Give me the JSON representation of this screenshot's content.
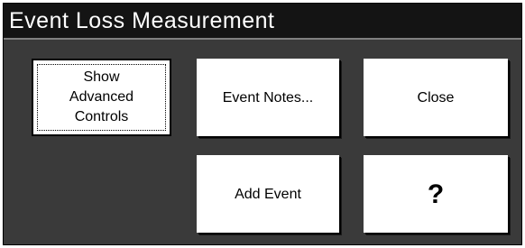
{
  "window": {
    "title": "Event Loss Measurement"
  },
  "buttons": {
    "show_advanced": "Show\nAdvanced\nControls",
    "event_notes": "Event Notes...",
    "close": "Close",
    "add_event": "Add Event",
    "help": "?"
  },
  "colors": {
    "window_background": "#3a3a3a",
    "title_bar_background": "#141414",
    "title_text": "#ffffff",
    "button_face": "#ffffff"
  }
}
